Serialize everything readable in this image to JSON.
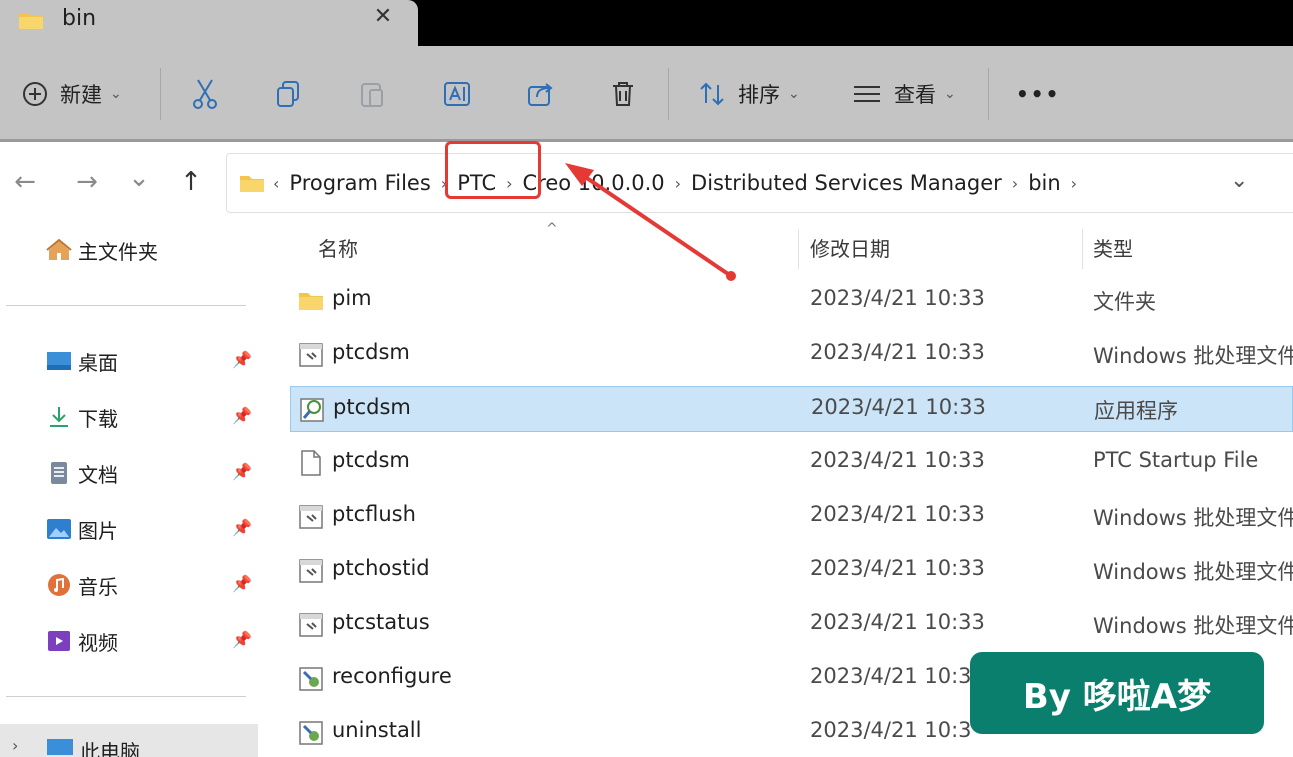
{
  "tab": {
    "title": "bin",
    "close": "✕"
  },
  "toolbar": {
    "new_label": "新建",
    "sort_label": "排序",
    "view_label": "查看",
    "more": "•••"
  },
  "nav": {
    "back": "←",
    "forward": "→",
    "recent": "⌄",
    "up": "↑"
  },
  "breadcrumb": [
    "Program Files",
    "PTC",
    "Creo 10.0.0.0",
    "Distributed Services Manager",
    "bin"
  ],
  "sidebar": {
    "home": "主文件夹",
    "items": [
      {
        "label": "桌面",
        "icon": "desktop-icon"
      },
      {
        "label": "下载",
        "icon": "download-icon"
      },
      {
        "label": "文档",
        "icon": "document-icon"
      },
      {
        "label": "图片",
        "icon": "picture-icon"
      },
      {
        "label": "音乐",
        "icon": "music-icon"
      },
      {
        "label": "视频",
        "icon": "video-icon"
      }
    ],
    "pc": "此电脑"
  },
  "columns": {
    "name": "名称",
    "date": "修改日期",
    "type": "类型"
  },
  "files": [
    {
      "name": "pim",
      "date": "2023/4/21 10:33",
      "type": "文件夹",
      "icon": "folder"
    },
    {
      "name": "ptcdsm",
      "date": "2023/4/21 10:33",
      "type": "Windows 批处理文件",
      "icon": "batch"
    },
    {
      "name": "ptcdsm",
      "date": "2023/4/21 10:33",
      "type": "应用程序",
      "icon": "exe",
      "selected": true
    },
    {
      "name": "ptcdsm",
      "date": "2023/4/21 10:33",
      "type": "PTC Startup File",
      "icon": "blank"
    },
    {
      "name": "ptcflush",
      "date": "2023/4/21 10:33",
      "type": "Windows 批处理文件",
      "icon": "batch"
    },
    {
      "name": "ptchostid",
      "date": "2023/4/21 10:33",
      "type": "Windows 批处理文件",
      "icon": "batch"
    },
    {
      "name": "ptcstatus",
      "date": "2023/4/21 10:33",
      "type": "Windows 批处理文件",
      "icon": "batch"
    },
    {
      "name": "reconfigure",
      "date": "2023/4/21 10:3",
      "type": "",
      "icon": "setup"
    },
    {
      "name": "uninstall",
      "date": "2023/4/21 10:3",
      "type": "",
      "icon": "setup"
    }
  ],
  "watermark": "By 哆啦A梦",
  "colors": {
    "accent": "#e53935",
    "selection": "#cce4f7",
    "watermark": "#0b7f6e"
  }
}
